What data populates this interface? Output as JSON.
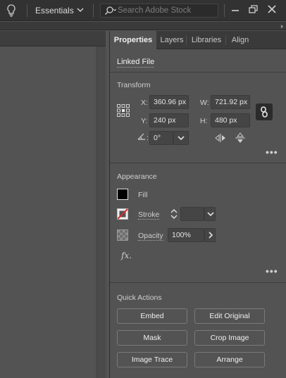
{
  "appbar": {
    "workspace": "Essentials",
    "search_placeholder": "Search Adobe Stock"
  },
  "panel": {
    "tabs": [
      "Properties",
      "Layers",
      "Libraries",
      "Align"
    ],
    "active_tab": "Properties",
    "linked_file": "Linked File",
    "transform": {
      "title": "Transform",
      "x_label": "X:",
      "x_value": "360.96 px",
      "y_label": "Y:",
      "y_value": "240 px",
      "w_label": "W:",
      "w_value": "721.92 px",
      "h_label": "H:",
      "h_value": "480 px",
      "rotate_label": ":",
      "rotate_value": "0°"
    },
    "appearance": {
      "title": "Appearance",
      "fill_label": "Fill",
      "stroke_label": "Stroke",
      "opacity_label": "Opacity",
      "opacity_value": "100%",
      "fx_label": "fx."
    },
    "quick_actions": {
      "title": "Quick Actions",
      "buttons": [
        "Embed",
        "Edit Original",
        "Mask",
        "Crop Image",
        "Image Trace",
        "Arrange"
      ]
    }
  },
  "colors": {
    "panel_bg": "#535353",
    "appbar_bg": "#323232",
    "fill_swatch": "#000000",
    "stroke_none": "#d42b2b"
  },
  "icons": [
    "lightbulb-icon",
    "chevron-down-icon",
    "search-icon",
    "minimize-icon",
    "restore-icon",
    "close-icon",
    "reference-point-icon",
    "link-proportions-icon",
    "rotate-icon",
    "flip-horizontal-icon",
    "flip-vertical-icon",
    "more-options-icon",
    "fx-icon"
  ]
}
